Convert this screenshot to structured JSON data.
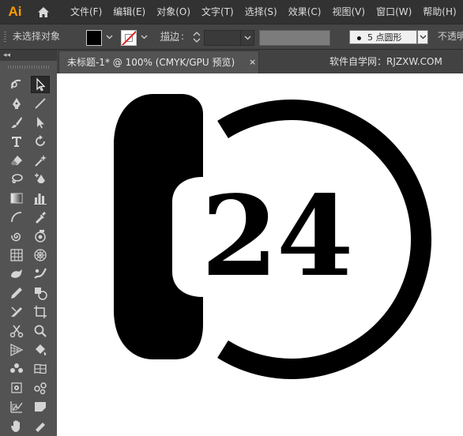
{
  "app": {
    "logo": "Ai",
    "home_icon": "home-icon"
  },
  "menu": [
    "文件(F)",
    "编辑(E)",
    "对象(O)",
    "文字(T)",
    "选择(S)",
    "效果(C)",
    "视图(V)",
    "窗口(W)",
    "帮助(H)"
  ],
  "control_bar": {
    "selection_status": "未选择对象",
    "fill_color": "#000000",
    "stroke_label": "描边",
    "stroke_colon": ":",
    "brush_text": "5 点圆形",
    "opacity_label": "不透明"
  },
  "toolbar": {
    "collapse": "◂◂",
    "tools": [
      "curvature-tool-icon",
      "direct-selection-tool-icon",
      "pen-tool-icon",
      "line-segment-tool-icon",
      "paintbrush-tool-icon",
      "selection-arrow-icon",
      "type-tool-icon",
      "rotate-tool-icon",
      "eraser-tool-icon",
      "magic-wand-icon",
      "lasso-tool-icon",
      "add-anchor-point-icon",
      "gradient-tool-icon",
      "column-graph-tool-icon",
      "arc-tool-icon",
      "eyedropper-tool-icon",
      "spiral-tool-icon",
      "symbol-sprayer-icon",
      "rectangular-grid-icon",
      "polar-grid-icon",
      "blob-brush-icon",
      "shaper-tool-icon",
      "pencil-tool-icon",
      "shape-builder-icon",
      "knife-tool-icon",
      "artboard-tool-icon",
      "scissors-tool-icon",
      "zoom-tool-icon",
      "perspective-grid-icon",
      "live-paint-bucket-icon",
      "blend-tool-icon",
      "mesh-tool-icon",
      "free-transform-icon",
      "puppet-warp-icon",
      "graph-data-icon",
      "slice-tool-icon",
      "hand-tool-icon",
      "eraser-small-icon"
    ]
  },
  "document": {
    "tab_title": "未标题-1* @ 100% (CMYK/GPU 预览)",
    "close": "×",
    "watermark": "软件自学网：RJZXW.COM"
  },
  "artwork": {
    "number_text": "24",
    "fill": "#000000"
  }
}
